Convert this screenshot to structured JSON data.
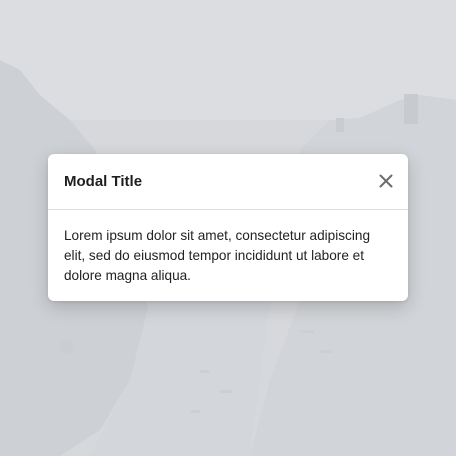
{
  "modal": {
    "title": "Modal Title",
    "body": "Lorem ipsum dolor sit amet, consectetur adipiscing elit, sed do eiusmod tempor incididunt ut labore et dolore magna aliqua.",
    "close_icon": "close-icon"
  },
  "colors": {
    "modal_background": "#ffffff",
    "title_text": "#1f1f1f",
    "body_text": "#222222",
    "divider": "#dcdcdc",
    "close_icon": "#6b6b6b",
    "backdrop_overlay": "#e0e2e5"
  }
}
